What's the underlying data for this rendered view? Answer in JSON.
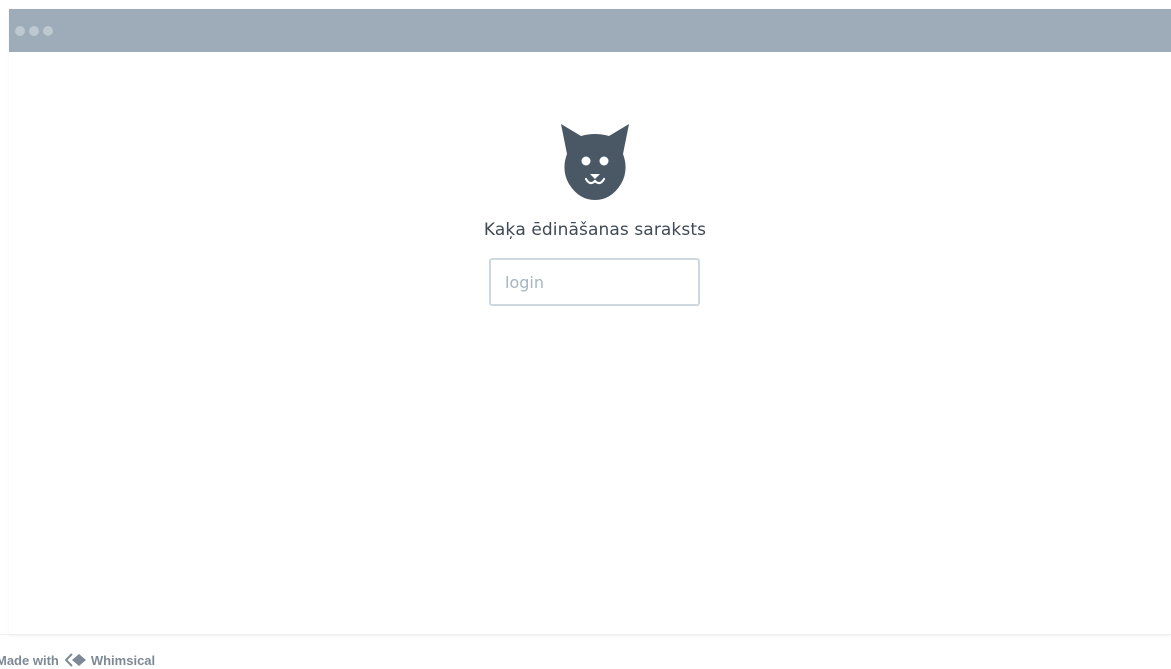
{
  "window": {
    "titlebar_color": "#9dacb8",
    "traffic_lights": [
      "dot",
      "dot",
      "dot"
    ]
  },
  "app": {
    "logo_icon": "cat-face-icon",
    "title": "Kaķa ēdināšanas saraksts",
    "login_placeholder": "login",
    "login_value": ""
  },
  "footer": {
    "made_with": "Made with",
    "brand": "Whimsical",
    "brand_icon": "whimsical-logo-icon"
  },
  "colors": {
    "icon": "#4a5866",
    "text": "#3f4a56",
    "input_border": "#cfd8df",
    "placeholder": "#a6b5c1"
  }
}
